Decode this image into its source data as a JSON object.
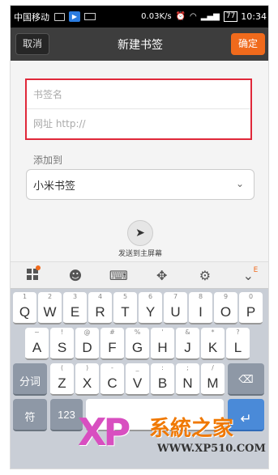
{
  "status_bar": {
    "carrier": "中国移动",
    "speed": "0.03K/s",
    "battery": "77",
    "time": "10:34"
  },
  "title_bar": {
    "cancel_label": "取消",
    "title": "新建书签",
    "confirm_label": "确定"
  },
  "form": {
    "name_placeholder": "书签名",
    "url_placeholder": "网址 http://",
    "add_to_label": "添加到",
    "folder_selected": "小米书签",
    "send_label": "发送到主屏幕"
  },
  "keyboard": {
    "row1": [
      {
        "hint": "1",
        "key": "Q"
      },
      {
        "hint": "2",
        "key": "W"
      },
      {
        "hint": "3",
        "key": "E"
      },
      {
        "hint": "4",
        "key": "R"
      },
      {
        "hint": "5",
        "key": "T"
      },
      {
        "hint": "6",
        "key": "Y"
      },
      {
        "hint": "7",
        "key": "U"
      },
      {
        "hint": "8",
        "key": "I"
      },
      {
        "hint": "9",
        "key": "O"
      },
      {
        "hint": "0",
        "key": "P"
      }
    ],
    "row2": [
      {
        "hint": "~",
        "key": "A"
      },
      {
        "hint": "!",
        "key": "S"
      },
      {
        "hint": "@",
        "key": "D"
      },
      {
        "hint": "#",
        "key": "F"
      },
      {
        "hint": "%",
        "key": "G"
      },
      {
        "hint": "'",
        "key": "H"
      },
      {
        "hint": "&",
        "key": "J"
      },
      {
        "hint": "*",
        "key": "K"
      },
      {
        "hint": "?",
        "key": "L"
      }
    ],
    "row3_left": "分词",
    "row3": [
      {
        "hint": "(",
        "key": "Z"
      },
      {
        "hint": ")",
        "key": "X"
      },
      {
        "hint": "-",
        "key": "C"
      },
      {
        "hint": "_",
        "key": "V"
      },
      {
        "hint": ":",
        "key": "B"
      },
      {
        "hint": ";",
        "key": "N"
      },
      {
        "hint": "/",
        "key": "M"
      }
    ],
    "symbol_key": "符",
    "number_key": "123"
  },
  "watermark": {
    "logo": "XP",
    "name": "系統之家",
    "url": "WWW.XP510.COM"
  },
  "colors": {
    "accent": "#f06a1c",
    "highlight_border": "#e0283a",
    "titlebar": "#3d3d3d"
  }
}
